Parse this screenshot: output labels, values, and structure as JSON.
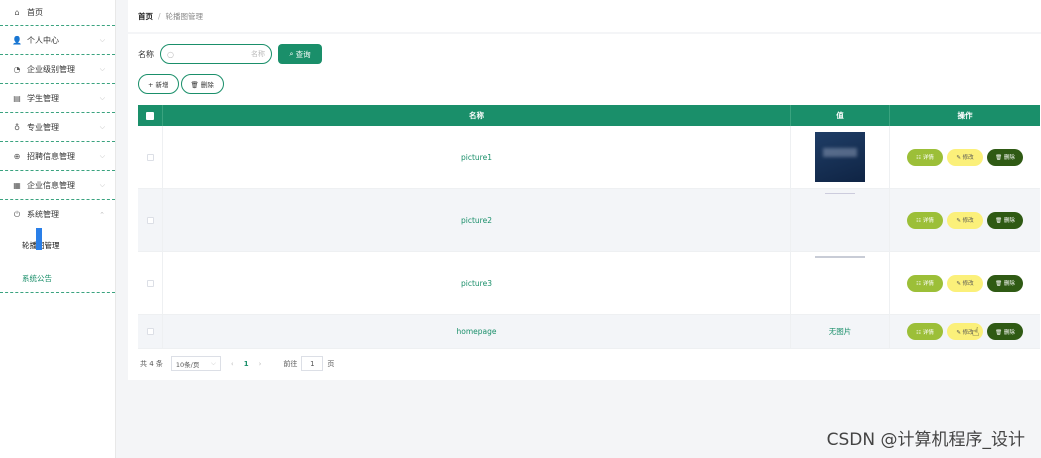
{
  "sidebar": {
    "items": [
      {
        "label": "首页",
        "icon": "home-icon",
        "glyph": "⌂"
      },
      {
        "label": "个人中心",
        "icon": "user-icon",
        "glyph": "👤"
      },
      {
        "label": "企业级别管理",
        "icon": "speed-icon",
        "glyph": "◔"
      },
      {
        "label": "学生管理",
        "icon": "list-icon",
        "glyph": "▤"
      },
      {
        "label": "专业管理",
        "icon": "mic-icon",
        "glyph": "♁"
      },
      {
        "label": "招聘信息管理",
        "icon": "globe-icon",
        "glyph": "⊕"
      },
      {
        "label": "企业信息管理",
        "icon": "doc-icon",
        "glyph": "▦"
      },
      {
        "label": "系统管理",
        "icon": "power-icon",
        "glyph": "⏻"
      }
    ],
    "sub": {
      "active": "轮播图管理",
      "notice": "系统公告"
    }
  },
  "breadcrumb": {
    "home": "首页",
    "sep": "/",
    "current": "轮播图管理"
  },
  "search": {
    "label": "名称",
    "placeholder": "名称",
    "button": "查询"
  },
  "actions": {
    "add": "+ 新增",
    "delete": "🗑 删除"
  },
  "table": {
    "headers": {
      "name": "名称",
      "value": "值",
      "ops": "操作"
    },
    "rows": [
      {
        "name": "picture1",
        "value": ""
      },
      {
        "name": "picture2",
        "value": ""
      },
      {
        "name": "picture3",
        "value": ""
      },
      {
        "name": "homepage",
        "value": "无图片"
      }
    ],
    "ops": {
      "detail": "☷ 详情",
      "edit": "✎ 修改",
      "del": "🗑 删除"
    }
  },
  "pager": {
    "total": "共 4 条",
    "size": "10条/页",
    "page": "1",
    "goto": "前往",
    "goto_value": "1",
    "unit": "页"
  },
  "watermark": "CSDN @计算机程序_设计",
  "colors": {
    "primary": "#1a8f6a",
    "detail": "#9cbf38",
    "edit": "#fbf07a",
    "del": "#2f5a14"
  }
}
